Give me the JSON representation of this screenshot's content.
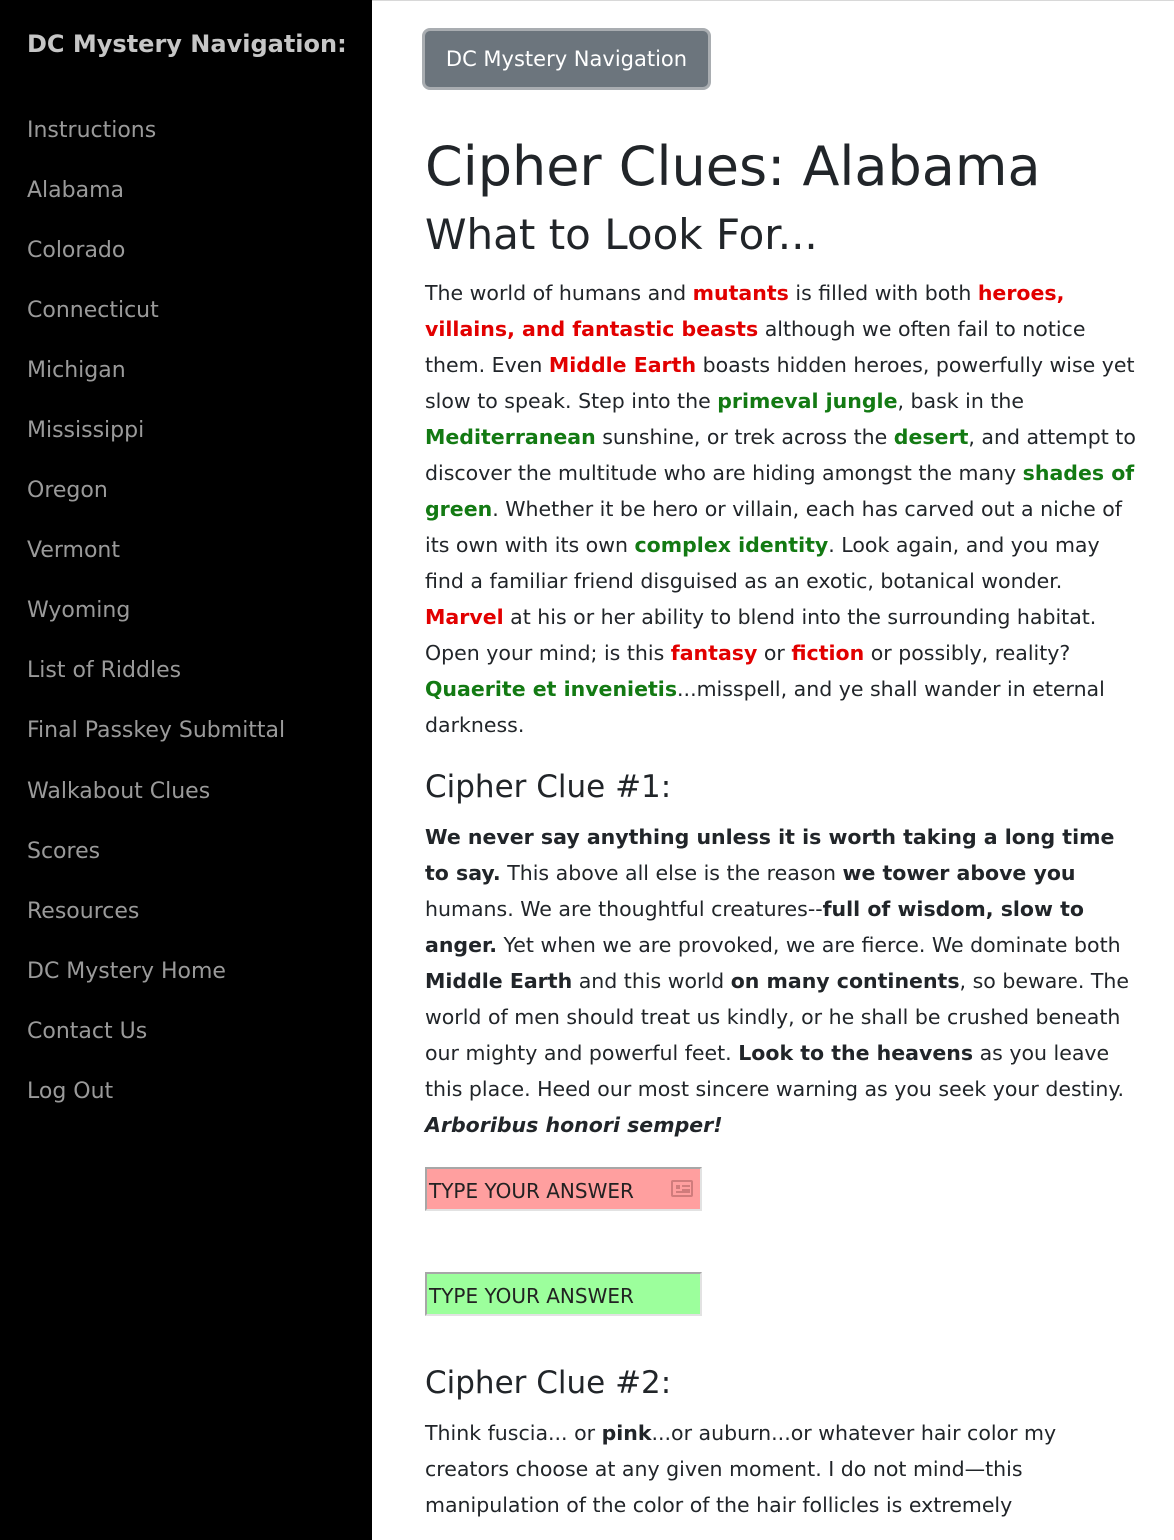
{
  "sidebar": {
    "title": "DC Mystery Navigation:",
    "items": [
      {
        "label": "Instructions"
      },
      {
        "label": "Alabama"
      },
      {
        "label": "Colorado"
      },
      {
        "label": "Connecticut"
      },
      {
        "label": "Michigan"
      },
      {
        "label": "Mississippi"
      },
      {
        "label": "Oregon"
      },
      {
        "label": "Vermont"
      },
      {
        "label": "Wyoming"
      },
      {
        "label": "List of Riddles"
      },
      {
        "label": "Final Passkey Submittal"
      },
      {
        "label": "Walkabout Clues"
      },
      {
        "label": "Scores"
      },
      {
        "label": "Resources"
      },
      {
        "label": "DC Mystery Home"
      },
      {
        "label": "Contact Us"
      },
      {
        "label": "Log Out"
      }
    ]
  },
  "header": {
    "nav_button_label": "DC Mystery Navigation"
  },
  "page": {
    "title": "Cipher Clues: Alabama",
    "subtitle": "What to Look For...",
    "intro": [
      {
        "t": "The world of humans and "
      },
      {
        "t": "mutants",
        "s": "red"
      },
      {
        "t": " is filled with both "
      },
      {
        "t": "heroes, villains, and fantastic beasts",
        "s": "red"
      },
      {
        "t": " although we often fail to notice them. Even "
      },
      {
        "t": "Middle Earth",
        "s": "red"
      },
      {
        "t": " boasts hidden heroes, powerfully wise yet slow to speak. Step into the "
      },
      {
        "t": "primeval jungle",
        "s": "green"
      },
      {
        "t": ", bask in the "
      },
      {
        "t": "Mediterranean",
        "s": "green"
      },
      {
        "t": " sunshine, or trek across the "
      },
      {
        "t": "desert",
        "s": "green"
      },
      {
        "t": ", and attempt to discover the multitude who are hiding amongst the many "
      },
      {
        "t": "shades of green",
        "s": "green"
      },
      {
        "t": ". Whether it be hero or villain, each has carved out a niche of its own with its own "
      },
      {
        "t": "complex identity",
        "s": "green"
      },
      {
        "t": ". Look again, and you may find a familiar friend disguised as an exotic, botanical wonder. "
      },
      {
        "t": "Marvel",
        "s": "red"
      },
      {
        "t": " at his or her ability to blend into the surrounding habitat. Open your mind; is this "
      },
      {
        "t": "fantasy",
        "s": "red"
      },
      {
        "t": " or "
      },
      {
        "t": "fiction",
        "s": "red"
      },
      {
        "t": " or possibly, reality? "
      },
      {
        "t": "Quaerite et invenietis",
        "s": "green"
      },
      {
        "t": "...misspell, and ye shall wander in eternal darkness."
      }
    ]
  },
  "clue1": {
    "heading": "Cipher Clue #1:",
    "text": [
      {
        "t": "We never say anything unless it is worth taking a long time to say.",
        "s": "b"
      },
      {
        "t": " This above all else is the reason "
      },
      {
        "t": "we tower above you",
        "s": "b"
      },
      {
        "t": " humans. We are thoughtful creatures--"
      },
      {
        "t": "full of wisdom, slow to anger.",
        "s": "b"
      },
      {
        "t": " Yet when we are provoked, we are fierce. We dominate both "
      },
      {
        "t": "Middle Earth",
        "s": "b"
      },
      {
        "t": " and this world "
      },
      {
        "t": "on many continents",
        "s": "b"
      },
      {
        "t": ", so beware. The world of men should treat us kindly, or he shall be crushed beneath our mighty and powerful feet. "
      },
      {
        "t": "Look to the heavens",
        "s": "b"
      },
      {
        "t": " as you leave this place. Heed our most sincere warning as you seek your destiny. "
      },
      {
        "t": "Arboribus honori semper!",
        "s": "bi"
      }
    ],
    "answer_placeholder_1": "TYPE YOUR ANSWER",
    "answer_placeholder_2": "TYPE YOUR ANSWER",
    "answer_icon": "contact-card-icon"
  },
  "clue2": {
    "heading": "Cipher Clue #2:",
    "text": [
      {
        "t": "Think fuscia... or "
      },
      {
        "t": "pink",
        "s": "b"
      },
      {
        "t": "...or auburn...or whatever hair color my creators choose at any given moment. I do not mind—this manipulation of the color of the hair follicles is extremely"
      }
    ]
  },
  "colors": {
    "sidebar_bg": "#000000",
    "sidebar_text": "#9a9a9a",
    "keyword_red": "#e20000",
    "keyword_green": "#137a13",
    "answer_wrong_bg": "#ff9f9f",
    "answer_right_bg": "#9cff9c",
    "nav_button_bg": "#6c757d"
  }
}
